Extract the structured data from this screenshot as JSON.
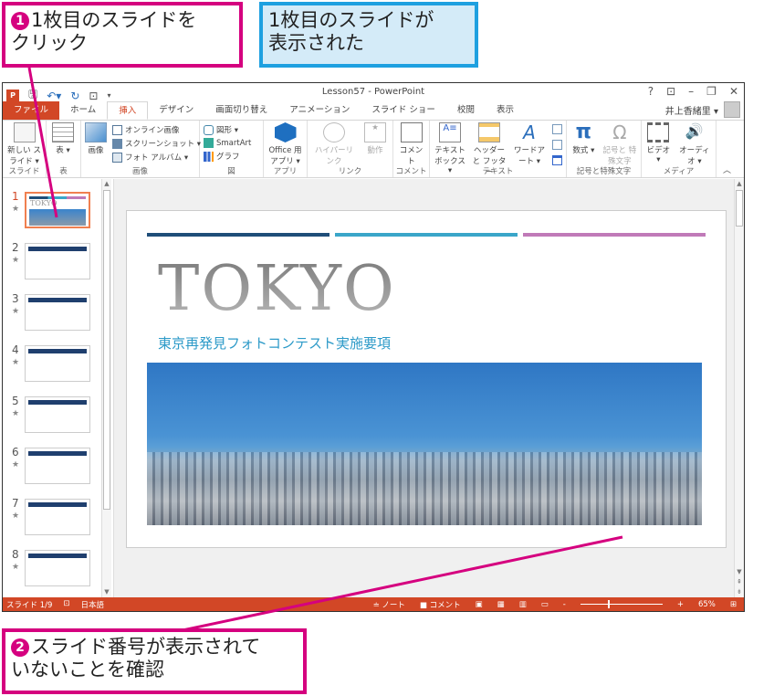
{
  "callouts": {
    "step1": {
      "num": "1",
      "text_line1": "1枚目のスライドを",
      "text_line2": "クリック"
    },
    "info": {
      "text_line1": "1枚目のスライドが",
      "text_line2": "表示された"
    },
    "step2": {
      "num": "2",
      "text_line1": "スライド番号が表示されて",
      "text_line2": "いないことを確認"
    }
  },
  "window": {
    "title": "Lesson57 - PowerPoint",
    "app_icon": "P",
    "controls": {
      "help": "?",
      "ribbon_options": "⊡",
      "minimize": "–",
      "restore": "❐",
      "close": "✕"
    },
    "user_name": "井上香緒里 ▾"
  },
  "tabs": [
    "ファイル",
    "ホーム",
    "挿入",
    "デザイン",
    "画面切り替え",
    "アニメーション",
    "スライド ショー",
    "校閲",
    "表示"
  ],
  "active_tab": "挿入",
  "ribbon": {
    "slides": {
      "new_slide": "新しい スライド ▾",
      "label": "スライド"
    },
    "table": {
      "table": "表 ▾",
      "label": "表"
    },
    "images": {
      "picture": "画像",
      "online": "オンライン画像",
      "screenshot": "スクリーンショット ▾",
      "album": "フォト アルバム ▾",
      "label": "画像"
    },
    "illustrations": {
      "shapes": "図形 ▾",
      "smartart": "SmartArt",
      "chart": "グラフ",
      "label": "図"
    },
    "apps": {
      "office_apps": "Office 用 アプリ ▾",
      "label": "アプリ"
    },
    "links": {
      "hyperlink": "ハイパーリンク",
      "action": "動作",
      "label": "リンク"
    },
    "comments": {
      "comment": "コメント",
      "label": "コメント"
    },
    "text": {
      "textbox": "テキスト ボックス ▾",
      "header_footer": "ヘッダーと フッター",
      "wordart": "ワードアート ▾",
      "label": "テキスト"
    },
    "symbols": {
      "equation": "数式 ▾",
      "symbol": "記号と 特殊文字",
      "label": "記号と特殊文字"
    },
    "media": {
      "video": "ビデオ ▾",
      "audio": "オーディオ ▾",
      "label": "メディア"
    }
  },
  "thumbnails": [
    {
      "num": "1",
      "selected": true
    },
    {
      "num": "2",
      "selected": false
    },
    {
      "num": "3",
      "selected": false
    },
    {
      "num": "4",
      "selected": false
    },
    {
      "num": "5",
      "selected": false
    },
    {
      "num": "6",
      "selected": false
    },
    {
      "num": "7",
      "selected": false
    },
    {
      "num": "8",
      "selected": false
    }
  ],
  "slide": {
    "title": "TOKYO",
    "subtitle": "東京再発見フォトコンテスト実施要項",
    "bar_colors": [
      "#1f4e79",
      "#3aa6c9",
      "#c07ab8"
    ]
  },
  "status": {
    "slide_indicator": "スライド 1/9",
    "language": "日本語",
    "notes": "≐ ノート",
    "comments": "■ コメント",
    "zoom_minus": "-",
    "zoom_plus": "+",
    "zoom_level": "65%"
  }
}
